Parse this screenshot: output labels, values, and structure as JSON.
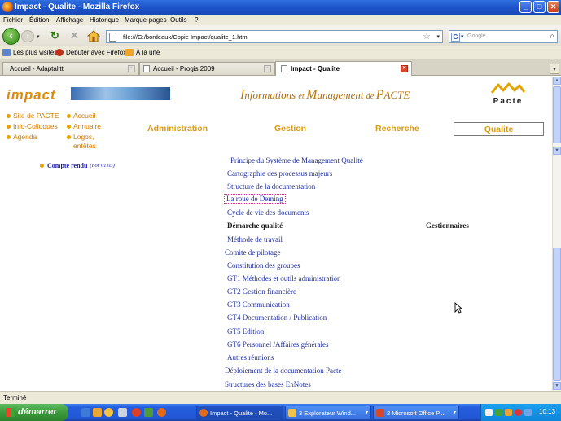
{
  "window": {
    "title": "Impact - Qualite - Mozilla Firefox"
  },
  "menu": [
    "Fichier",
    "Édition",
    "Affichage",
    "Historique",
    "Marque-pages",
    "Outils",
    "?"
  ],
  "navbar": {
    "url": "file:///G:/bordeaux/Copie Impact/qualite_1.htm",
    "search_placeholder": "Google"
  },
  "bookmarks": [
    "Les plus visités",
    "Débuter avec Firefox",
    "À la une"
  ],
  "tabs": [
    {
      "label": "Accueil - Adaptalitt",
      "active": false
    },
    {
      "label": "Accueil - Progis 2009",
      "active": false
    },
    {
      "label": "Impact - Qualite",
      "active": true
    }
  ],
  "page": {
    "logo": "impact",
    "info_title": {
      "i": "I",
      "nformations": "nformations ",
      "et": "et ",
      "m": "M",
      "anagement": "anagement ",
      "de": "de ",
      "p": "P",
      "acte": "ACTE"
    },
    "pacte_logo": "Pacte",
    "left_links": [
      "Site de PACTE",
      "Info-Colloques",
      "Agenda"
    ],
    "right_links": [
      "Accueil",
      "Annuaire",
      "Logos,",
      "entêtes"
    ],
    "nav": [
      "Administration",
      "Gestion",
      "Recherche",
      "Qualite"
    ],
    "compte_rendu": {
      "label": "Compte rendu",
      "sub": "(For 01.03)"
    },
    "doc_links_top": [
      "Principe du Système de Management Qualité",
      "Cartographie des processus majeurs",
      "Structure de la documentation",
      "La roue de Deming",
      "Cycle de vie des documents"
    ],
    "section_left": "Démarche qualité",
    "section_right": "Gestionnaires",
    "doc_links_bottom": [
      "Méthode de travail",
      "Comite de pilotage",
      "Constitution des groupes",
      "GT1 Méthodes et outils administration",
      "GT2 Gestion financière",
      "GT3 Communication",
      "GT4 Documentation / Publication",
      "GT5 Edition",
      "GT6 Personnel /Affaires générales",
      "Autres réunions",
      "Déploiement de la documentation Pacte",
      "Structures des bases EnNotes"
    ]
  },
  "status": "Terminé",
  "taskbar": {
    "start": "démarrer",
    "tasks": [
      {
        "label": "Impact - Qualite - Mo...",
        "active": true
      },
      {
        "label": "3 Explorateur Wind...",
        "active": false
      },
      {
        "label": "2 Microsoft Office P...",
        "active": false
      }
    ],
    "clock": "10:13"
  }
}
